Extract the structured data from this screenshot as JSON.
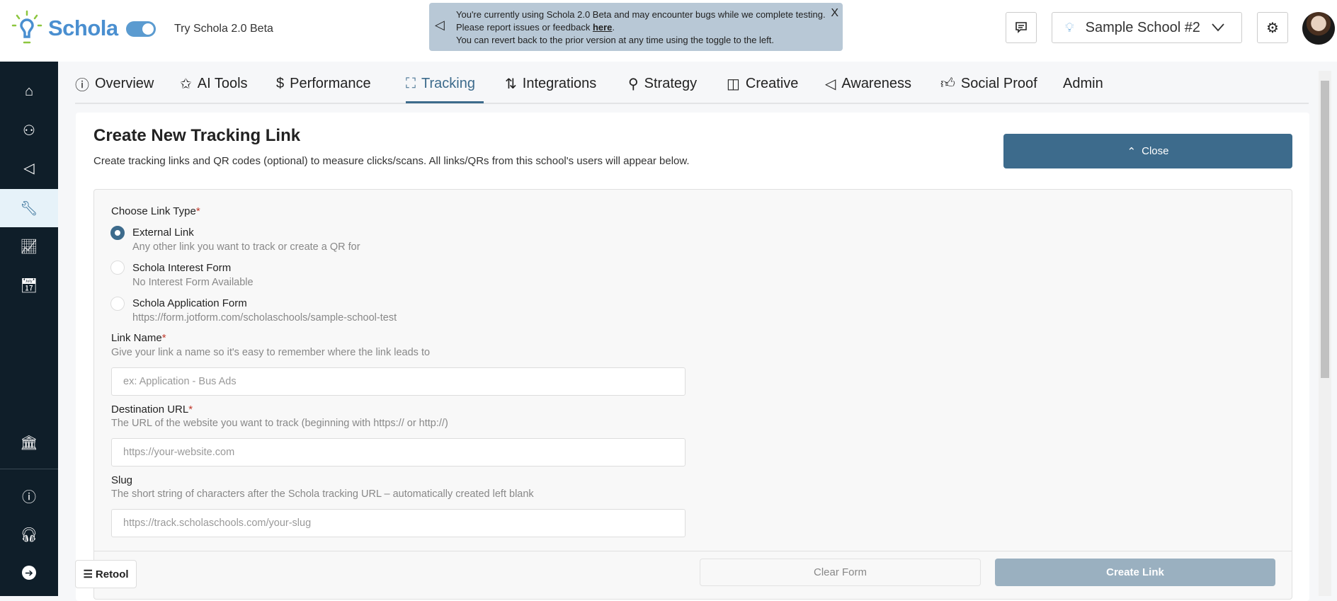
{
  "header": {
    "logo": "Schola",
    "toggle_on": true,
    "try_label": "Try Schola 2.0 Beta",
    "banner": {
      "line1": "You're currently using Schola 2.0 Beta and may encounter bugs while we complete testing.",
      "line2_prefix": "Please report issues or feedback ",
      "line2_link": "here",
      "line2_suffix": ".",
      "line3": "You can revert back to the prior version at any time using the toggle to the left.",
      "close": "X"
    },
    "school": "Sample School #2"
  },
  "sidebar": {
    "items": [
      "home",
      "user-search",
      "megaphone",
      "wrench",
      "chart",
      "calendar",
      "school",
      "info",
      "headset",
      "arrow-right"
    ],
    "active": "wrench"
  },
  "tabs": [
    {
      "label": "Overview",
      "icon": "info"
    },
    {
      "label": "AI Tools",
      "icon": "magic-wand"
    },
    {
      "label": "Performance",
      "icon": "dollar-doc"
    },
    {
      "label": "Tracking",
      "icon": "scan",
      "active": true
    },
    {
      "label": "Integrations",
      "icon": "sync"
    },
    {
      "label": "Strategy",
      "icon": "flow"
    },
    {
      "label": "Creative",
      "icon": "pencils"
    },
    {
      "label": "Awareness",
      "icon": "megaphone"
    },
    {
      "label": "Social Proof",
      "icon": "thumbs-up"
    },
    {
      "label": "Admin",
      "icon": ""
    }
  ],
  "form": {
    "title": "Create New Tracking Link",
    "subtitle": "Create tracking links and QR codes (optional) to measure clicks/scans. All links/QRs from this school's users will appear below.",
    "close_label": "Close",
    "link_type_label": "Choose Link Type",
    "required": "*",
    "options": [
      {
        "label": "External Link",
        "desc": "Any other link you want to track or create a QR for",
        "selected": true
      },
      {
        "label": "Schola Interest Form",
        "desc": "No Interest Form Available"
      },
      {
        "label": "Schola Application Form",
        "desc": "https://form.jotform.com/scholaschools/sample-school-test"
      }
    ],
    "link_name": {
      "label": "Link Name",
      "desc": "Give your link a name so it's easy to remember where the link leads to",
      "placeholder": "ex: Application - Bus Ads",
      "value": ""
    },
    "destination": {
      "label": "Destination URL",
      "desc": "The URL of the website you want to track (beginning with https:// or http://)",
      "placeholder": "https://your-website.com",
      "value": ""
    },
    "slug": {
      "label": "Slug",
      "desc": "The short string of characters after the Schola tracking URL – automatically created left blank",
      "placeholder": "https://track.scholaschools.com/your-slug",
      "value": ""
    },
    "clear_label": "Clear Form",
    "create_label": "Create Link"
  },
  "retool": "Retool",
  "colors": {
    "primary": "#3d6b8c",
    "sidebar": "#0f1e29",
    "banner": "#b8c8d6",
    "disabled": "#9ab0c0"
  }
}
